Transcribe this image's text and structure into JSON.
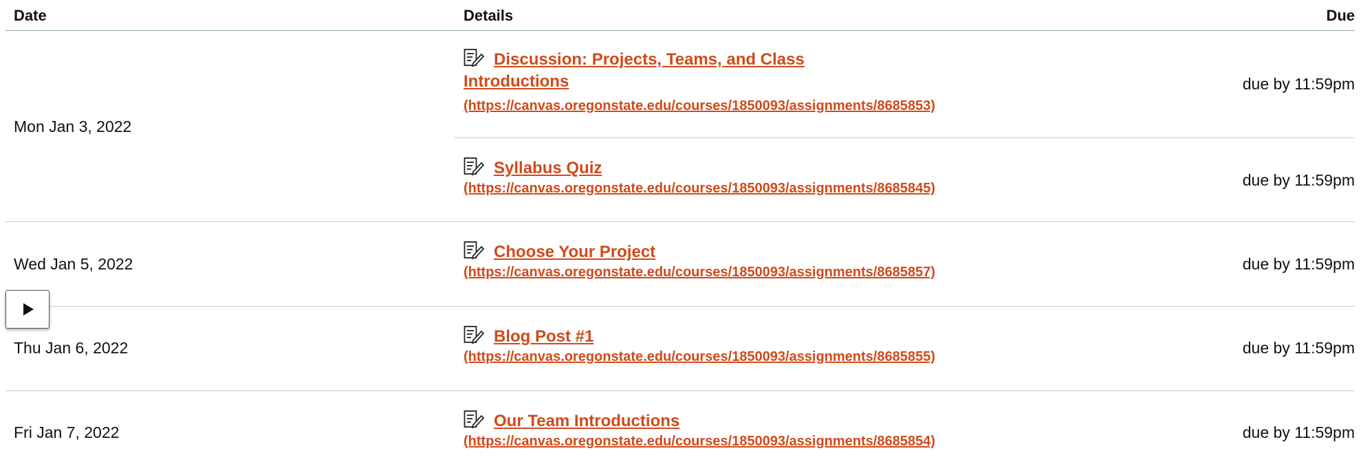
{
  "header": {
    "date_label": "Date",
    "details_label": "Details",
    "due_label": "Due"
  },
  "rows": [
    {
      "date": "Mon Jan 3, 2022",
      "items": [
        {
          "title_line1": "Discussion: Projects, Teams, and Class",
          "title_line2": "Introductions",
          "url": "(https://canvas.oregonstate.edu/courses/1850093/assignments/8685853)",
          "due": "due by 11:59pm",
          "icon": "assignment-icon"
        },
        {
          "title_line1": "Syllabus Quiz",
          "url": "(https://canvas.oregonstate.edu/courses/1850093/assignments/8685845)",
          "due": "due by 11:59pm",
          "icon": "assignment-icon"
        }
      ]
    },
    {
      "date": "Wed Jan 5, 2022",
      "items": [
        {
          "title_line1": "Choose Your Project",
          "url": "(https://canvas.oregonstate.edu/courses/1850093/assignments/8685857)",
          "due": "due by 11:59pm",
          "icon": "assignment-icon"
        }
      ]
    },
    {
      "date": "Thu Jan 6, 2022",
      "items": [
        {
          "title_line1": "Blog Post #1",
          "url": "(https://canvas.oregonstate.edu/courses/1850093/assignments/8685855)",
          "due": "due by 11:59pm",
          "icon": "assignment-icon"
        }
      ]
    },
    {
      "date": "Fri Jan 7, 2022",
      "items": [
        {
          "title_line1": "Our Team Introductions",
          "url": "(https://canvas.oregonstate.edu/courses/1850093/assignments/8685854)",
          "due": "due by 11:59pm",
          "icon": "assignment-icon"
        }
      ]
    }
  ],
  "overlay": {
    "play_icon": "play-icon"
  },
  "colors": {
    "link": "#d04a1a",
    "header_rule": "#8fa6a6",
    "row_rule": "#c8cccc"
  }
}
